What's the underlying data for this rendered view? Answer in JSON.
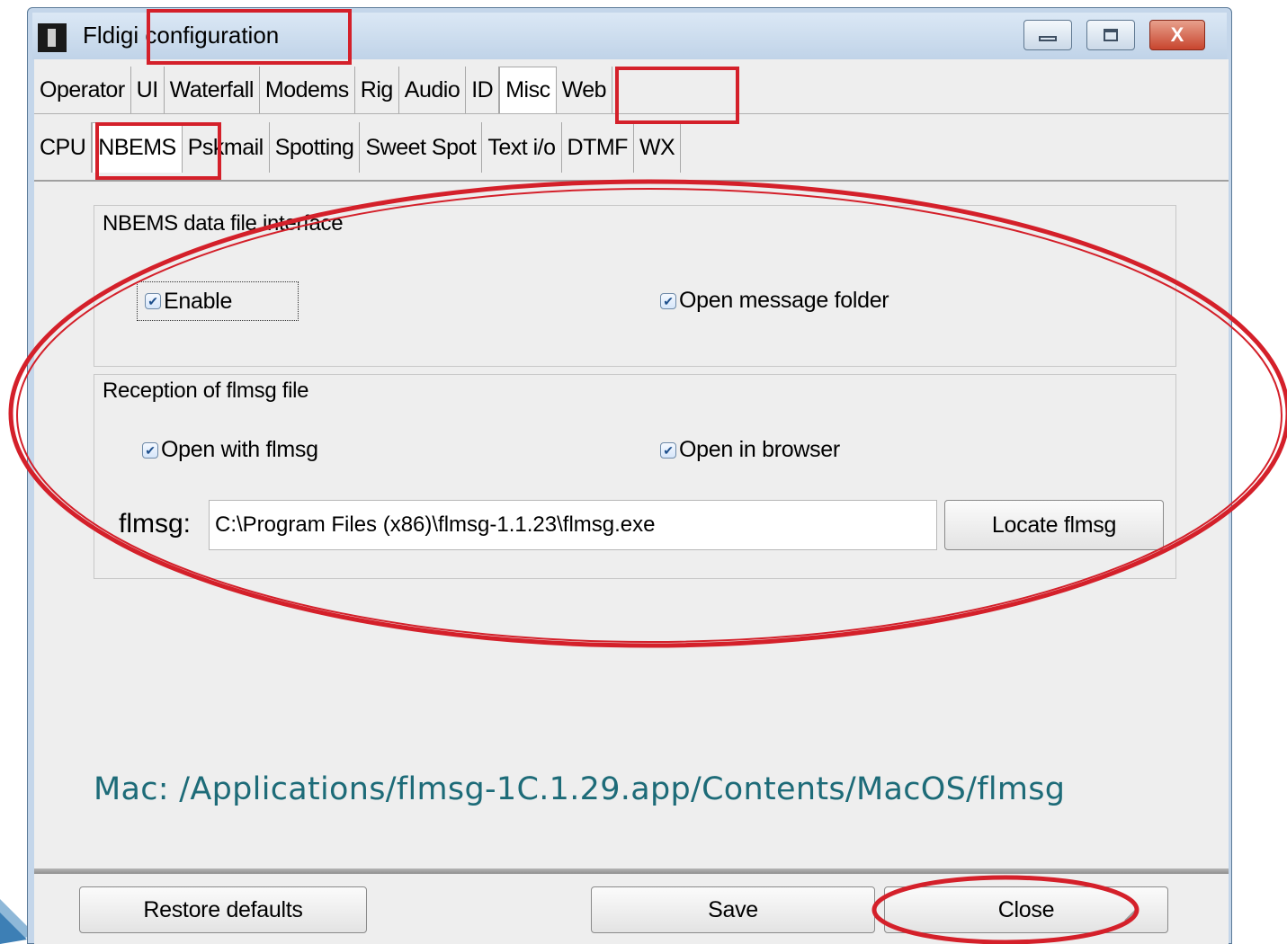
{
  "window": {
    "title": "Fldigi configuration",
    "close_glyph": "X"
  },
  "tabs_top": [
    "Operator",
    "UI",
    "Waterfall",
    "Modems",
    "Rig",
    "Audio",
    "ID",
    "Misc",
    "Web"
  ],
  "tabs_top_active": "Misc",
  "tabs_sub": [
    "CPU",
    "NBEMS",
    "Pskmail",
    "Spotting",
    "Sweet Spot",
    "Text i/o",
    "DTMF",
    "WX"
  ],
  "tabs_sub_active": "NBEMS",
  "nbems_group": {
    "label": "NBEMS data file interface",
    "enable_label": "Enable",
    "enable_checked": true,
    "open_folder_label": "Open message folder",
    "open_folder_checked": true
  },
  "reception_group": {
    "label": "Reception of flmsg file",
    "open_flmsg_label": "Open with flmsg",
    "open_flmsg_checked": true,
    "open_browser_label": "Open in browser",
    "open_browser_checked": true,
    "path_label": "flmsg:",
    "path_value": "C:\\Program Files (x86)\\flmsg-1.1.23\\flmsg.exe",
    "locate_button": "Locate flmsg"
  },
  "mac_note": "Mac: /Applications/flmsg-1C.1.29.app/Contents/MacOS/flmsg",
  "buttons": {
    "restore": "Restore defaults",
    "save": "Save",
    "close": "Close"
  },
  "colors": {
    "annotation_red": "#d4202a",
    "note_teal": "#1d6b78"
  }
}
